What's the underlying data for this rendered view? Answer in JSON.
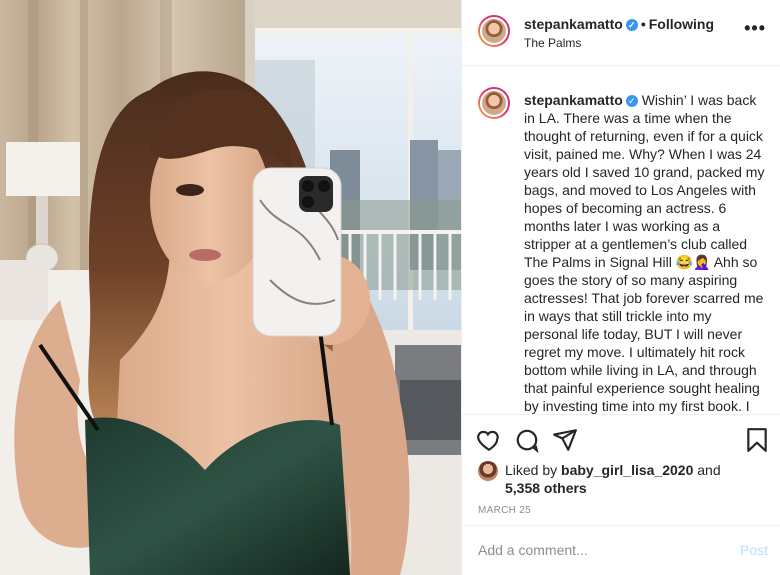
{
  "post": {
    "username": "stepankamatto",
    "verified_icon": "verified-badge-icon",
    "separator": "•",
    "follow_status": "Following",
    "location": "The Palms",
    "more_icon": "more-options-icon",
    "more_label": "•••"
  },
  "caption": {
    "username": "stepankamatto",
    "text": "Wishin’ I was back in LA. There was a time when the thought of returning, even if for a quick visit, pained me. Why? When I was 24 years old I saved 10 grand, packed my bags, and moved to Los Angeles with hopes of becoming an actress. 6 months later I was working as a stripper at a gentlemen’s club called The Palms in Signal Hill 😂🤦‍♀️ Ahh so goes the story of so many aspiring actresses! That job forever scarred me in ways that still trickle into my personal life today, BUT I will never regret my move. I ultimately hit rock bottom while living in LA, and through that painful experience sought healing by investing time into my first book. I took lemons and made something"
  },
  "actions": {
    "like_icon": "heart-icon",
    "comment_icon": "comment-icon",
    "share_icon": "share-icon",
    "save_icon": "bookmark-icon"
  },
  "likes": {
    "prefix": "Liked by",
    "liker": "baby_girl_lisa_2020",
    "conj": "and",
    "others": "5,358 others"
  },
  "date": "MARCH 25",
  "comment": {
    "placeholder": "Add a comment...",
    "post_label": "Post"
  },
  "colors": {
    "accent": "#3897f0",
    "post_disabled": "#b2dffc",
    "muted": "#8e8e8e",
    "text": "#262626"
  }
}
